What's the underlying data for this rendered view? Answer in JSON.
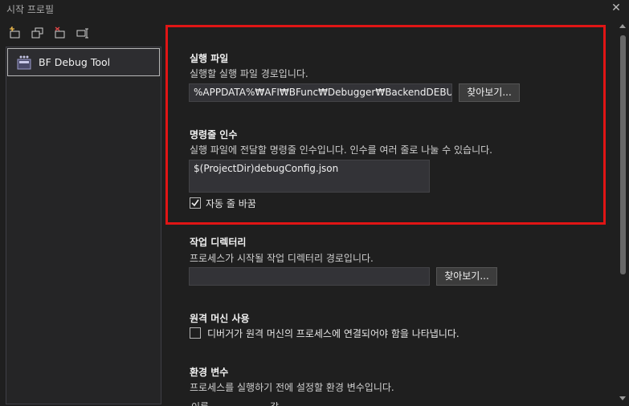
{
  "window": {
    "title": "시작 프로필",
    "close_glyph": "✕"
  },
  "toolbar": {
    "icons": [
      "new-profile-icon",
      "copy-profile-icon",
      "delete-profile-icon",
      "rename-profile-icon"
    ]
  },
  "profiles": [
    {
      "label": "BF Debug Tool",
      "icon": "profile-icon"
    }
  ],
  "executable": {
    "title": "실행 파일",
    "desc": "실행할 실행 파일 경로입니다.",
    "value": "%APPDATA%₩AFI₩BFunc₩Debugger₩BackendDEBUG.exe",
    "browse": "찾아보기..."
  },
  "arguments": {
    "title": "명령줄 인수",
    "desc": "실행 파일에 전달할 명령줄 인수입니다. 인수를 여러 줄로 나눌 수 있습니다.",
    "value": "$(ProjectDir)debugConfig.json",
    "wrap_label": "자동 줄 바꿈",
    "wrap_checked": true
  },
  "workdir": {
    "title": "작업 디렉터리",
    "desc": "프로세스가 시작될 작업 디렉터리 경로입니다.",
    "value": "",
    "browse": "찾아보기..."
  },
  "remote": {
    "title": "원격 머신 사용",
    "desc": "디버거가 원격 머신의 프로세스에 연결되어야 함을 나타냅니다.",
    "checked": false
  },
  "env": {
    "title": "환경 변수",
    "desc": "프로세스를 실행하기 전에 설정할 환경 변수입니다.",
    "col_name": "이름",
    "col_value": "값"
  },
  "colors": {
    "highlight": "#e01515",
    "background": "#1f1f1f",
    "panel": "#252526"
  }
}
